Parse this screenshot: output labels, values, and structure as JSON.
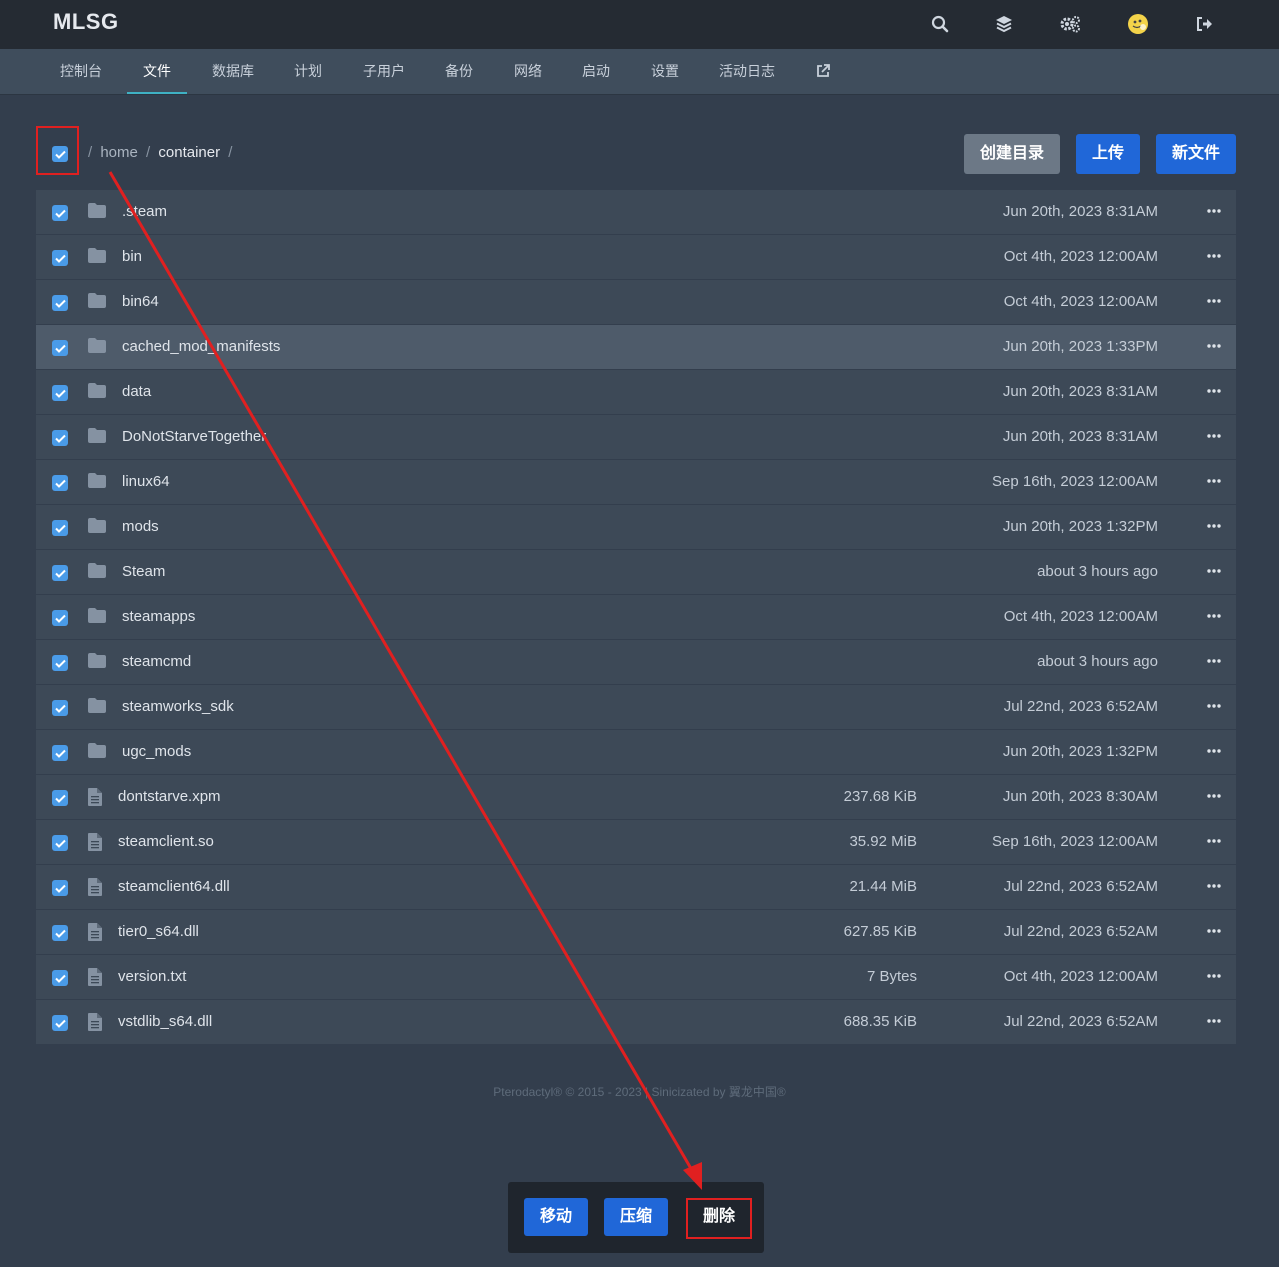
{
  "brand": "MLSG",
  "top_icons": [
    "search-icon",
    "layers-icon",
    "cogs-icon",
    "avatar",
    "logout-icon"
  ],
  "nav_tabs": [
    {
      "label": "控制台"
    },
    {
      "label": "文件"
    },
    {
      "label": "数据库"
    },
    {
      "label": "计划"
    },
    {
      "label": "子用户"
    },
    {
      "label": "备份"
    },
    {
      "label": "网络"
    },
    {
      "label": "启动"
    },
    {
      "label": "设置"
    },
    {
      "label": "活动日志"
    }
  ],
  "external_icon": "external-link-icon",
  "active_tab": "文件",
  "breadcrumb": {
    "sep": "/",
    "segments": [
      "home",
      "container"
    ]
  },
  "toolbar": {
    "mkdir": "创建目录",
    "upload": "上传",
    "new_file": "新文件"
  },
  "files": [
    {
      "name": ".steam",
      "type": "folder",
      "size": "",
      "date": "Jun 20th, 2023 8:31AM"
    },
    {
      "name": "bin",
      "type": "folder",
      "size": "",
      "date": "Oct 4th, 2023 12:00AM"
    },
    {
      "name": "bin64",
      "type": "folder",
      "size": "",
      "date": "Oct 4th, 2023 12:00AM"
    },
    {
      "name": "cached_mod_manifests",
      "type": "folder",
      "size": "",
      "date": "Jun 20th, 2023 1:33PM"
    },
    {
      "name": "data",
      "type": "folder",
      "size": "",
      "date": "Jun 20th, 2023 8:31AM"
    },
    {
      "name": "DoNotStarveTogether",
      "type": "folder",
      "size": "",
      "date": "Jun 20th, 2023 8:31AM"
    },
    {
      "name": "linux64",
      "type": "folder",
      "size": "",
      "date": "Sep 16th, 2023 12:00AM"
    },
    {
      "name": "mods",
      "type": "folder",
      "size": "",
      "date": "Jun 20th, 2023 1:32PM"
    },
    {
      "name": "Steam",
      "type": "folder",
      "size": "",
      "date": "about 3 hours ago"
    },
    {
      "name": "steamapps",
      "type": "folder",
      "size": "",
      "date": "Oct 4th, 2023 12:00AM"
    },
    {
      "name": "steamcmd",
      "type": "folder",
      "size": "",
      "date": "about 3 hours ago"
    },
    {
      "name": "steamworks_sdk",
      "type": "folder",
      "size": "",
      "date": "Jul 22nd, 2023 6:52AM"
    },
    {
      "name": "ugc_mods",
      "type": "folder",
      "size": "",
      "date": "Jun 20th, 2023 1:32PM"
    },
    {
      "name": "dontstarve.xpm",
      "type": "file",
      "size": "237.68 KiB",
      "date": "Jun 20th, 2023 8:30AM"
    },
    {
      "name": "steamclient.so",
      "type": "file",
      "size": "35.92 MiB",
      "date": "Sep 16th, 2023 12:00AM"
    },
    {
      "name": "steamclient64.dll",
      "type": "file",
      "size": "21.44 MiB",
      "date": "Jul 22nd, 2023 6:52AM"
    },
    {
      "name": "tier0_s64.dll",
      "type": "file",
      "size": "627.85 KiB",
      "date": "Jul 22nd, 2023 6:52AM"
    },
    {
      "name": "version.txt",
      "type": "file",
      "size": "7 Bytes",
      "date": "Oct 4th, 2023 12:00AM"
    },
    {
      "name": "vstdlib_s64.dll",
      "type": "file",
      "size": "688.35 KiB",
      "date": "Jul 22nd, 2023 6:52AM"
    }
  ],
  "highlighted_row": "cached_mod_manifests",
  "footer": "Pterodactyl® © 2015 - 2023 | Sinicizated by 翼龙中国®",
  "actions": {
    "move": "移动",
    "compress": "压缩",
    "delete": "删除"
  },
  "colors": {
    "accent": "#2067d8",
    "annotation": "#e02020",
    "checkbox": "#4a9be8"
  }
}
